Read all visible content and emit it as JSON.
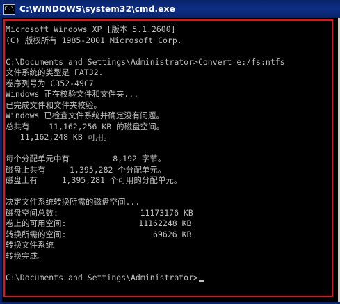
{
  "window": {
    "title": "C:\\WINDOWS\\system32\\cmd.exe",
    "icon": "cmd-icon",
    "icon_glyph": "C:\\"
  },
  "console": {
    "lines": [
      "Microsoft Windows XP [版本 5.1.2600]",
      "(C) 版权所有 1985-2001 Microsoft Corp.",
      "",
      "C:\\Documents and Settings\\Administrator>Convert e:/fs:ntfs",
      "文件系统的类型是 FAT32.",
      "卷序列号为 C352-49C7",
      "Windows 正在校验文件和文件夹...",
      "已完成文件和文件夹校验。",
      "Windows 已检查文件系统并确定没有问题。",
      "总共有    11,162,256 KB 的磁盘空间。",
      "   11,162,248 KB 可用。",
      "",
      "每个分配单元中有         8,192 字节。",
      "磁盘上共有     1,395,282 个分配单元。",
      "磁盘上有     1,395,281 个可用的分配单元。",
      "",
      "决定文件系统转换所需的磁盘空间...",
      "磁盘空间总数:                 11173176 KB",
      "卷上的可用空间:               11162248 KB",
      "转换所需的空间:                  69626 KB",
      "转换文件系统",
      "转换完成。",
      "",
      "C:\\Documents and Settings\\Administrator>"
    ]
  },
  "colors": {
    "console_bg": "#000000",
    "console_text": "#c0c0c0",
    "titlebar": "#0a246a",
    "highlight_border": "#e0141c"
  }
}
